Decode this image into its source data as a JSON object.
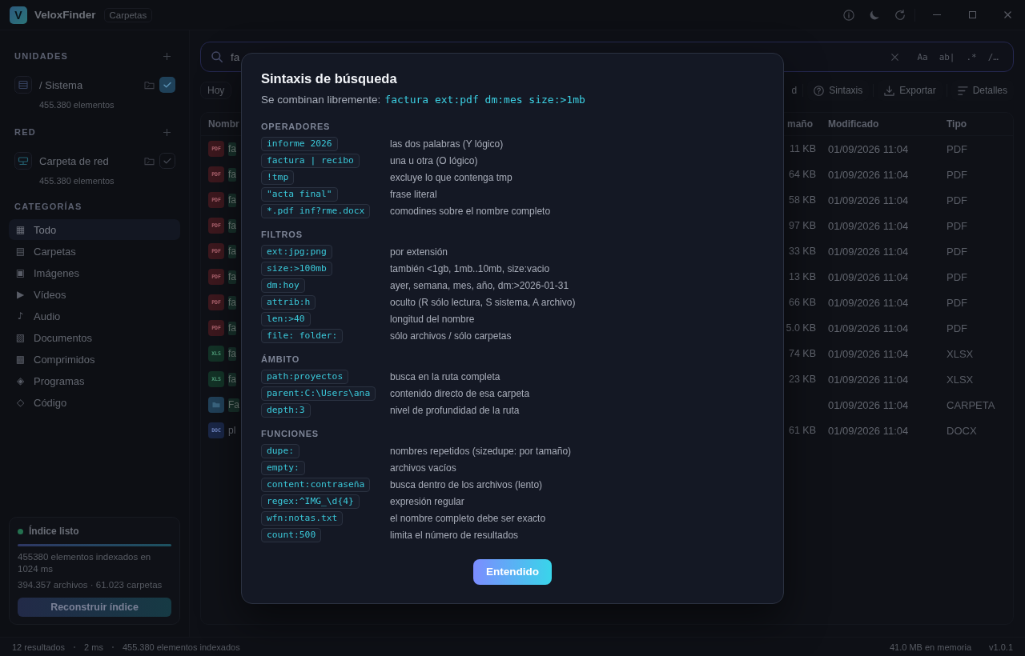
{
  "titlebar": {
    "logo": "V",
    "app_name": "VeloxFinder",
    "badge": "Carpetas"
  },
  "sidebar": {
    "sections": [
      {
        "title": "UNIDADES",
        "items": [
          {
            "kind": "local",
            "name": "/ Sistema",
            "count": "455.380 elementos",
            "checked": true
          }
        ]
      },
      {
        "title": "RED",
        "items": [
          {
            "kind": "network",
            "name": "Carpeta de red",
            "count": "455.380 elementos",
            "checked": false
          }
        ]
      }
    ],
    "categories_title": "CATEGORÍAS",
    "categories": [
      {
        "icon": "▦",
        "label": "Todo",
        "selected": true
      },
      {
        "icon": "▤",
        "label": "Carpetas",
        "selected": false
      },
      {
        "icon": "▣",
        "label": "Imágenes",
        "selected": false
      },
      {
        "icon": "▶",
        "label": "Vídeos",
        "selected": false
      },
      {
        "icon": "♪",
        "label": "Audio",
        "selected": false
      },
      {
        "icon": "▧",
        "label": "Documentos",
        "selected": false
      },
      {
        "icon": "▩",
        "label": "Comprimidos",
        "selected": false
      },
      {
        "icon": "◈",
        "label": "Programas",
        "selected": false
      },
      {
        "icon": "◇",
        "label": "Código",
        "selected": false
      }
    ],
    "index_card": {
      "ready": true,
      "title": "Índice listo",
      "level": 1,
      "summary": "455380 elementos indexados en 1024 ms",
      "counts": "394.357 archivos · 61.023 carpetas",
      "button": "Reconstruir índice"
    }
  },
  "search": {
    "value": "fa",
    "options": [
      {
        "label": "Aa"
      },
      {
        "label": "ab|"
      },
      {
        "label": ".*"
      },
      {
        "label": "/…"
      }
    ]
  },
  "toolbar": {
    "left_chips": [
      {
        "label": "Hoy"
      }
    ],
    "right_chips": [
      {
        "label": "d"
      }
    ],
    "buttons": [
      {
        "kind": "syntax",
        "label": "Sintaxis"
      },
      {
        "kind": "export",
        "label": "Exportar"
      },
      {
        "kind": "details",
        "label": "Detalles"
      }
    ]
  },
  "table": {
    "columns": [
      {
        "label": "Nombr"
      },
      {
        "label": "maño"
      },
      {
        "label": "Modificado"
      },
      {
        "label": "Tipo"
      }
    ],
    "rows": [
      {
        "kind": "pdf",
        "badge": "PDF",
        "name": "fa",
        "match": true,
        "size": "11 KB",
        "modified": "01/09/2026 11:04",
        "type": "PDF"
      },
      {
        "kind": "pdf",
        "badge": "PDF",
        "name": "fa",
        "match": true,
        "size": "64 KB",
        "modified": "01/09/2026 11:04",
        "type": "PDF"
      },
      {
        "kind": "pdf",
        "badge": "PDF",
        "name": "fa",
        "match": true,
        "size": "58 KB",
        "modified": "01/09/2026 11:04",
        "type": "PDF"
      },
      {
        "kind": "pdf",
        "badge": "PDF",
        "name": "fa",
        "match": true,
        "size": "97 KB",
        "modified": "01/09/2026 11:04",
        "type": "PDF"
      },
      {
        "kind": "pdf",
        "badge": "PDF",
        "name": "fa",
        "match": true,
        "size": "33 KB",
        "modified": "01/09/2026 11:04",
        "type": "PDF"
      },
      {
        "kind": "pdf",
        "badge": "PDF",
        "name": "fa",
        "match": true,
        "size": "13 KB",
        "modified": "01/09/2026 11:04",
        "type": "PDF"
      },
      {
        "kind": "pdf",
        "badge": "PDF",
        "name": "fa",
        "match": true,
        "size": "66 KB",
        "modified": "01/09/2026 11:04",
        "type": "PDF"
      },
      {
        "kind": "pdf",
        "badge": "PDF",
        "name": "fa",
        "match": true,
        "size": "5.0 KB",
        "modified": "01/09/2026 11:04",
        "type": "PDF"
      },
      {
        "kind": "xls",
        "badge": "XLS",
        "name": "fa",
        "match": true,
        "size": "74 KB",
        "modified": "01/09/2026 11:04",
        "type": "XLSX"
      },
      {
        "kind": "xls",
        "badge": "XLS",
        "name": "fa",
        "match": true,
        "size": "23 KB",
        "modified": "01/09/2026 11:04",
        "type": "XLSX"
      },
      {
        "kind": "folder",
        "name": "Fa",
        "match": true,
        "modified": "01/09/2026 11:04",
        "type": "CARPETA"
      },
      {
        "kind": "doc",
        "badge": "DOC",
        "name": "pl",
        "match": false,
        "size": "61 KB",
        "modified": "01/09/2026 11:04",
        "type": "DOCX"
      }
    ]
  },
  "status_bar": {
    "left": [
      "12 resultados",
      "2 ms",
      "455.380 elementos indexados"
    ],
    "right": [
      "41.0 MB en memoria",
      "v1.0.1"
    ]
  },
  "dialog": {
    "title": "Sintaxis de búsqueda",
    "intro": "Se combinan libremente:",
    "example": "factura ext:pdf dm:mes size:>1mb",
    "sections": [
      {
        "title": "OPERADORES",
        "rows": [
          {
            "syntax": "informe 2026",
            "description": "las dos palabras (Y lógico)"
          },
          {
            "syntax": "factura | recibo",
            "description": "una u otra (O lógico)"
          },
          {
            "syntax": "!tmp",
            "description": "excluye lo que contenga tmp"
          },
          {
            "syntax": "\"acta final\"",
            "description": "frase literal"
          },
          {
            "syntax": "*.pdf inf?rme.docx",
            "description": "comodines sobre el nombre completo"
          }
        ]
      },
      {
        "title": "FILTROS",
        "rows": [
          {
            "syntax": "ext:jpg;png",
            "description": "por extensión"
          },
          {
            "syntax": "size:>100mb",
            "description": "también <1gb, 1mb..10mb, size:vacio"
          },
          {
            "syntax": "dm:hoy",
            "description": "ayer, semana, mes, año, dm:>2026-01-31"
          },
          {
            "syntax": "attrib:h",
            "description": "oculto (R sólo lectura, S sistema, A archivo)"
          },
          {
            "syntax": "len:>40",
            "description": "longitud del nombre"
          },
          {
            "syntax": "file: folder:",
            "description": "sólo archivos / sólo carpetas"
          }
        ]
      },
      {
        "title": "ÁMBITO",
        "rows": [
          {
            "syntax": "path:proyectos",
            "description": "busca en la ruta completa"
          },
          {
            "syntax": "parent:C:\\Users\\ana",
            "description": "contenido directo de esa carpeta"
          },
          {
            "syntax": "depth:3",
            "description": "nivel de profundidad de la ruta"
          }
        ]
      },
      {
        "title": "FUNCIONES",
        "rows": [
          {
            "syntax": "dupe:",
            "description": "nombres repetidos (sizedupe: por tamaño)"
          },
          {
            "syntax": "empty:",
            "description": "archivos vacíos"
          },
          {
            "syntax": "content:contraseña",
            "description": "busca dentro de los archivos (lento)"
          },
          {
            "syntax": "regex:^IMG_\\d{4}",
            "description": "expresión regular"
          },
          {
            "syntax": "wfn:notas.txt",
            "description": "el nombre completo debe ser exacto"
          },
          {
            "syntax": "count:500",
            "description": "limita el número de resultados"
          }
        ]
      }
    ],
    "button": "Entendido"
  }
}
